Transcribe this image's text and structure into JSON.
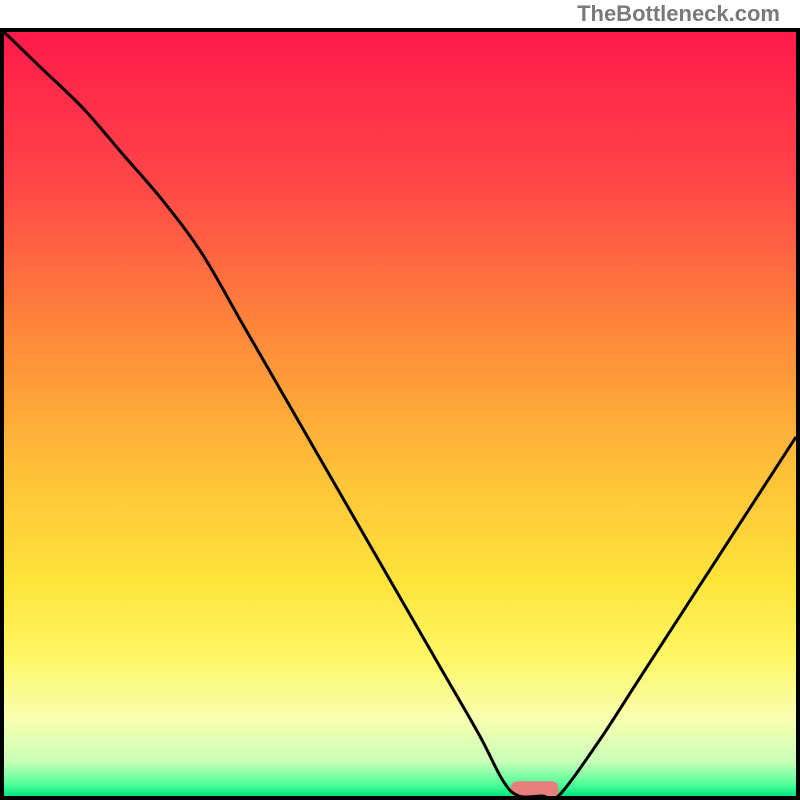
{
  "watermark": "TheBottleneck.com",
  "chart_data": {
    "type": "line",
    "title": "",
    "xlabel": "",
    "ylabel": "",
    "xlim": [
      0,
      100
    ],
    "ylim": [
      0,
      100
    ],
    "grid": false,
    "legend": false,
    "axis_ticks_visible": false,
    "curve_note": "Single black curve descending from top-left, reaching a minimum plateau around x≈65-70, then rising toward the right edge. y-values are a qualitative bottleneck metric (100=worst, 0=best).",
    "x": [
      0,
      5,
      10,
      15,
      20,
      25,
      30,
      35,
      40,
      45,
      50,
      55,
      60,
      63,
      65,
      68,
      70,
      75,
      80,
      85,
      90,
      95,
      100
    ],
    "y": [
      100,
      95,
      90,
      84,
      78,
      71,
      62,
      53,
      44,
      35,
      26,
      17,
      8,
      2,
      0,
      0,
      0,
      7,
      15,
      23,
      31,
      39,
      47
    ],
    "optimum_marker": {
      "x": 67,
      "y": 0,
      "width": 6,
      "height": 2.2,
      "color": "#e77f7d"
    },
    "background_gradient": {
      "type": "vertical",
      "stops": [
        {
          "pos": 0.0,
          "color": "#ff1a4b"
        },
        {
          "pos": 0.2,
          "color": "#ff4747"
        },
        {
          "pos": 0.4,
          "color": "#ff8a3a"
        },
        {
          "pos": 0.58,
          "color": "#ffc238"
        },
        {
          "pos": 0.72,
          "color": "#ffe43a"
        },
        {
          "pos": 0.82,
          "color": "#fff766"
        },
        {
          "pos": 0.9,
          "color": "#f7ffb0"
        },
        {
          "pos": 0.955,
          "color": "#c9ffb8"
        },
        {
          "pos": 0.985,
          "color": "#4fff9a"
        },
        {
          "pos": 1.0,
          "color": "#00e67a"
        }
      ]
    },
    "frame_color": "#000000",
    "frame_width": 4
  }
}
